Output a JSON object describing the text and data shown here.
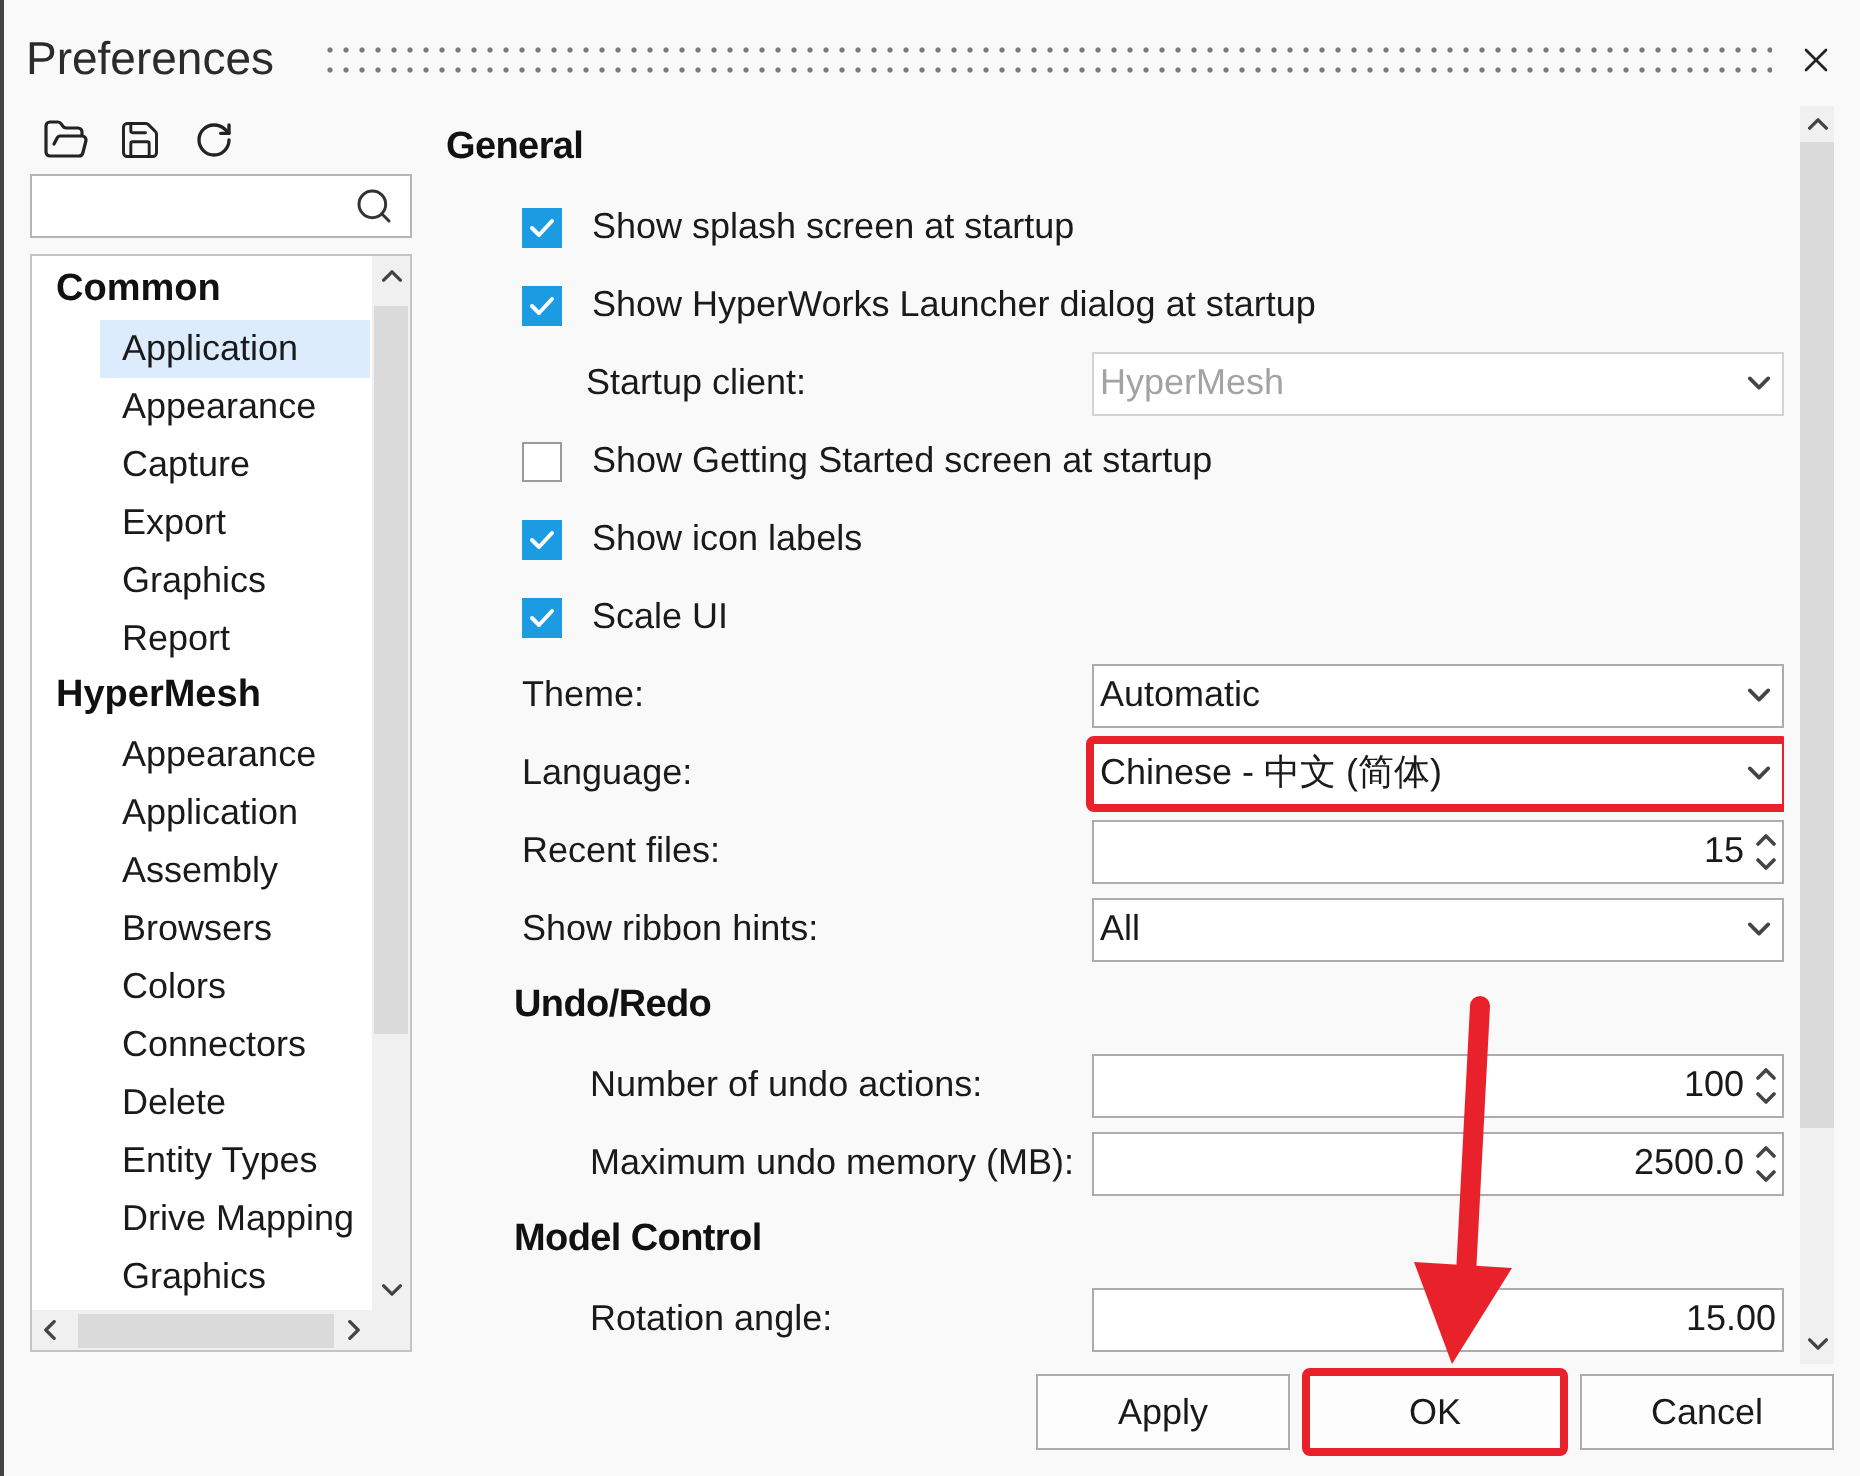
{
  "window": {
    "title": "Preferences"
  },
  "sidebar": {
    "groups": [
      {
        "label": "Common",
        "selected": false,
        "children": [
          {
            "label": "Application",
            "selected": true
          },
          {
            "label": "Appearance",
            "selected": false
          },
          {
            "label": "Capture",
            "selected": false
          },
          {
            "label": "Export",
            "selected": false
          },
          {
            "label": "Graphics",
            "selected": false
          },
          {
            "label": "Report",
            "selected": false
          }
        ]
      },
      {
        "label": "HyperMesh",
        "selected": false,
        "children": [
          {
            "label": "Appearance",
            "selected": false
          },
          {
            "label": "Application",
            "selected": false
          },
          {
            "label": "Assembly",
            "selected": false
          },
          {
            "label": "Browsers",
            "selected": false
          },
          {
            "label": "Colors",
            "selected": false
          },
          {
            "label": "Connectors",
            "selected": false
          },
          {
            "label": "Delete",
            "selected": false
          },
          {
            "label": "Entity Types",
            "selected": false
          },
          {
            "label": "Drive Mapping",
            "selected": false
          },
          {
            "label": "Graphics",
            "selected": false
          }
        ]
      }
    ]
  },
  "content": {
    "sections": [
      {
        "title": "General",
        "rows": [
          {
            "kind": "checkbox",
            "label": "Show splash screen at startup",
            "checked": true
          },
          {
            "kind": "checkbox",
            "label": "Show HyperWorks Launcher dialog at startup",
            "checked": true,
            "children": [
              {
                "kind": "select",
                "label": "Startup client:",
                "value": "HyperMesh",
                "disabled": true,
                "highlighted": false
              }
            ]
          },
          {
            "kind": "checkbox",
            "label": "Show Getting Started screen at startup",
            "checked": false
          },
          {
            "kind": "checkbox",
            "label": "Show icon labels",
            "checked": true
          },
          {
            "kind": "checkbox",
            "label": "Scale UI",
            "checked": true
          },
          {
            "kind": "select",
            "label": "Theme:",
            "value": "Automatic",
            "disabled": false,
            "highlighted": false
          },
          {
            "kind": "select",
            "label": "Language:",
            "value": "Chinese - 中文 (简体)",
            "disabled": false,
            "highlighted": true
          },
          {
            "kind": "spin",
            "label": "Recent files:",
            "value": "15",
            "disabled": false,
            "highlighted": false
          },
          {
            "kind": "select",
            "label": "Show ribbon hints:",
            "value": "All",
            "disabled": false,
            "highlighted": false
          }
        ],
        "children": [
          {
            "title": "Undo/Redo",
            "rows": [
              {
                "kind": "spin",
                "label": "Number of undo actions:",
                "value": "100",
                "disabled": false,
                "highlighted": false
              },
              {
                "kind": "spin",
                "label": "Maximum undo memory (MB):",
                "value": "2500.0",
                "disabled": false,
                "highlighted": false
              }
            ]
          },
          {
            "title": "Model Control",
            "rows": [
              {
                "kind": "input",
                "label": "Rotation angle:",
                "value": "15.00",
                "disabled": false,
                "highlighted": false
              }
            ]
          }
        ]
      }
    ]
  },
  "buttons": [
    {
      "label": "Apply",
      "highlighted": false
    },
    {
      "label": "OK",
      "highlighted": true
    },
    {
      "label": "Cancel",
      "highlighted": false
    }
  ]
}
